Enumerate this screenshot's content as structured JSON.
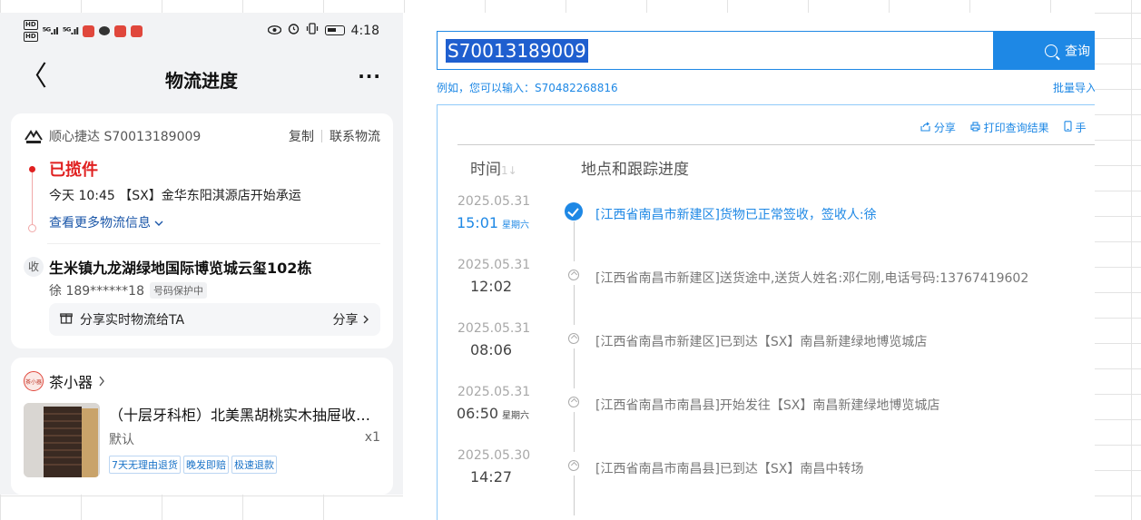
{
  "phone": {
    "status_bar": {
      "hd1": "HD",
      "hd2": "HD",
      "sig1": "⁵ᴳ.ıl",
      "sig2": "⁵ᴳ.ıl",
      "time": "4:18"
    },
    "nav": {
      "back_glyph": "〈",
      "title": "物流进度",
      "more_glyph": "···"
    },
    "carrier": {
      "name_and_number": "顺心捷达 S70013189009",
      "copy_label": "复制",
      "contact_label": "联系物流"
    },
    "timeline": {
      "status": "已揽件",
      "detail": "今天 10:45 【SX】金华东阳淇源店开始承运",
      "more_link": "查看更多物流信息"
    },
    "receiver": {
      "badge": "收",
      "address": "生米镇九龙湖绿地国际博览城云玺102栋",
      "name_phone": "徐 189******18",
      "privacy_tag": "号码保护中"
    },
    "share": {
      "label": "分享实时物流给TA",
      "action": "分享"
    },
    "shop": {
      "logo_text": "茶小器",
      "name": "茶小器"
    },
    "product": {
      "title": "（十层牙科柜）北美黑胡桃实木抽屉收…",
      "spec": "默认",
      "qty": "x1",
      "tags": [
        "7天无理由退货",
        "晚发即赔",
        "极速退款"
      ]
    }
  },
  "web": {
    "search": {
      "value": "S70013189009",
      "button_label": "查询"
    },
    "hint": "例如，您可以输入：S70482268816",
    "batch_label": "批量导入",
    "tools": {
      "share": "分享",
      "print": "打印查询结果",
      "phone": "手"
    },
    "table": {
      "col_time": "时间",
      "col_location": "地点和跟踪进度",
      "rows": [
        {
          "date": "2025.05.31",
          "time": "15:01",
          "weekday": "星期六",
          "text": "[江西省南昌市新建区]货物已正常签收，签收人:徐"
        },
        {
          "date": "2025.05.31",
          "time": "12:02",
          "weekday": "",
          "text": "[江西省南昌市新建区]送货途中,送货人姓名:邓仁刚,电话号码:13767419602"
        },
        {
          "date": "2025.05.31",
          "time": "08:06",
          "weekday": "",
          "text": "[江西省南昌市新建区]已到达【SX】南昌新建绿地博览城店"
        },
        {
          "date": "2025.05.31",
          "time": "06:50",
          "weekday": "星期六",
          "text": "[江西省南昌市南昌县]开始发往【SX】南昌新建绿地博览城店"
        },
        {
          "date": "2025.05.30",
          "time": "14:27",
          "weekday": "",
          "text": "[江西省南昌市南昌县]已到达【SX】南昌中转场"
        }
      ]
    }
  },
  "colors": {
    "accent_blue": "#1e88e5",
    "status_red": "#e02020",
    "link_blue": "#1a56a8"
  }
}
